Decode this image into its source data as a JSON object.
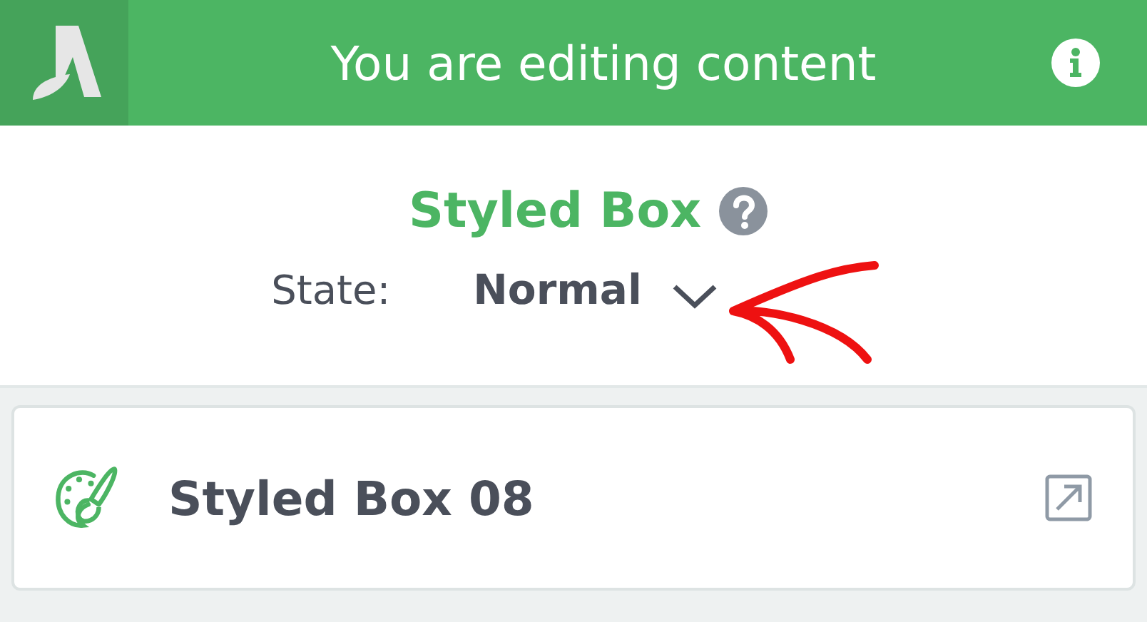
{
  "header": {
    "title": "You are editing content"
  },
  "panel": {
    "title": "Styled Box",
    "state_label": "State:",
    "state_value": "Normal"
  },
  "element": {
    "name": "Styled Box 08"
  }
}
